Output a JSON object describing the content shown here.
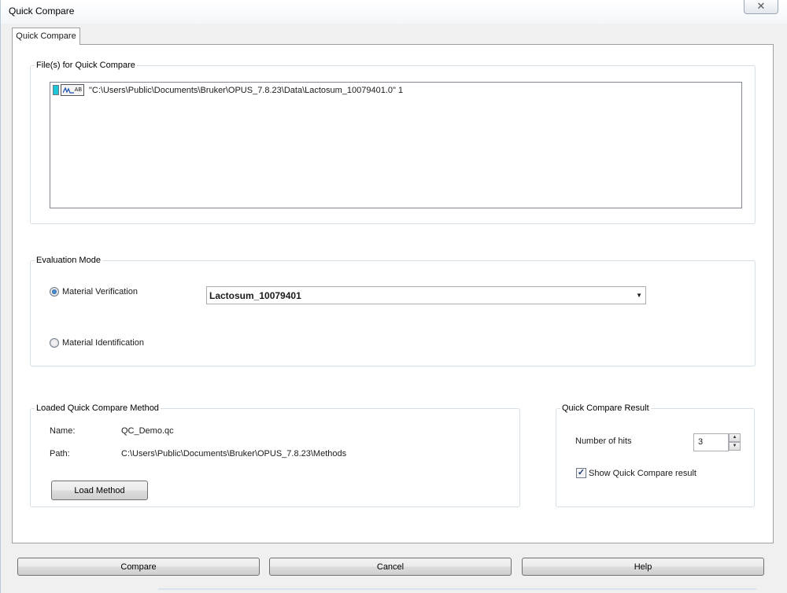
{
  "window": {
    "title": "Quick Compare",
    "close_symbol": "✕"
  },
  "tabs": [
    {
      "label": "Quick Compare"
    }
  ],
  "files_group": {
    "label": "File(s) for Quick Compare",
    "icon_text": "AB",
    "files": [
      {
        "path": "\"C:\\Users\\Public\\Documents\\Bruker\\OPUS_7.8.23\\Data\\Lactosum_10079401.0\" 1"
      }
    ]
  },
  "evaluation_group": {
    "label": "Evaluation Mode",
    "option_verification": "Material Verification",
    "option_identification": "Material Identification",
    "selected": "verification",
    "reference_value": "Lactosum_10079401",
    "dropdown_arrow": "▼"
  },
  "method_group": {
    "label": "Loaded Quick Compare Method",
    "name_label": "Name:",
    "name_value": "QC_Demo.qc",
    "path_label": "Path:",
    "path_value": "C:\\Users\\Public\\Documents\\Bruker\\OPUS_7.8.23\\Methods",
    "load_button": "Load Method"
  },
  "result_group": {
    "label": "Quick Compare Result",
    "hits_label": "Number of hits",
    "hits_value": "3",
    "spin_up": "▲",
    "spin_down": "▼",
    "show_result_label": "Show Quick Compare result",
    "show_result_checked": true,
    "check_mark": "✓"
  },
  "footer": {
    "compare_button": "Compare",
    "cancel_button": "Cancel",
    "help_button": "Help"
  }
}
